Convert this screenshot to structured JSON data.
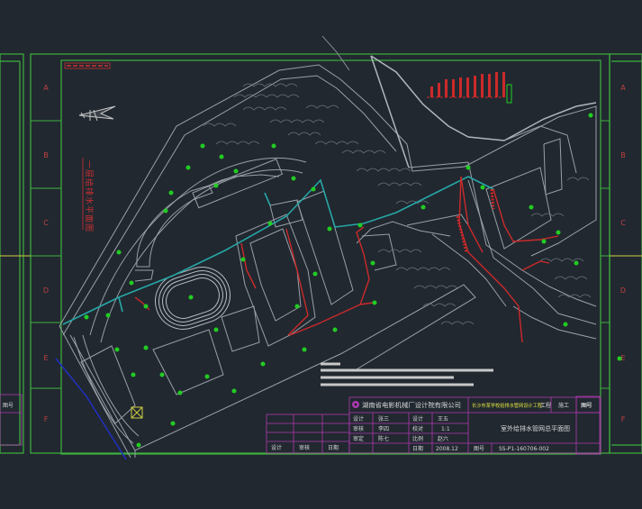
{
  "drawing": {
    "title_vertical": "一层给排水平面图",
    "zone_rows": [
      "A",
      "B",
      "C",
      "D",
      "E",
      "F"
    ],
    "company": "湖南省电影机械厂设计院有限公司",
    "project": "长沙市某学校给排水管网设计工程",
    "stage_label": "工程",
    "stage_value": "施工",
    "corner_label": "图号",
    "sheet_title": "室外给排水管网总平面图",
    "drawn_by_label": "设计",
    "drawn_by_value": "张三",
    "checker_label": "审核",
    "checker_value": "李四",
    "design_label": "设计",
    "design_value": "王五",
    "check_label": "校对",
    "check_value": "赵六",
    "approve_label": "审定",
    "approve_value": "陈七",
    "scale_label": "比例",
    "scale_value": "1:1",
    "date_label": "日期",
    "date_value": "2008.12",
    "sheet_no_label": "图号",
    "sheet_no_value": "SS-P1-160706-002",
    "revision_headers": [
      "设计",
      "审核",
      "日期"
    ]
  },
  "colors": {
    "background": "#212830",
    "frame": "#3eb23e",
    "site": "#9aa0a8",
    "water_main": "#26a6a6",
    "drain": "#cc2a2a",
    "fixture": "#22cc22",
    "titleblock_line": "#b038b0",
    "text": "#d8d8d8",
    "text_highlight": "#e0e040"
  }
}
